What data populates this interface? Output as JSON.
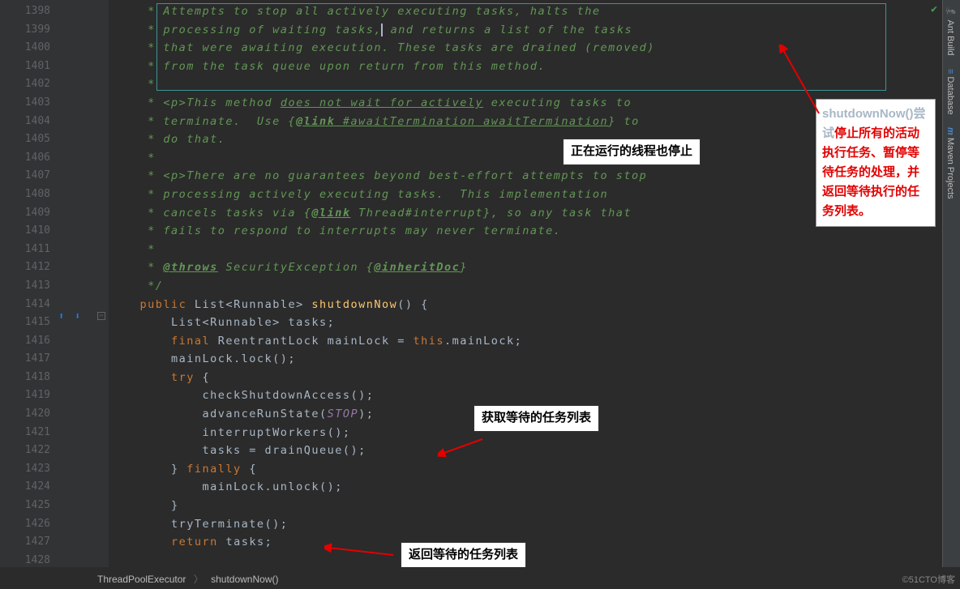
{
  "line_numbers": [
    "1398",
    "1399",
    "1400",
    "1401",
    "1402",
    "1403",
    "1404",
    "1405",
    "1406",
    "1407",
    "1408",
    "1409",
    "1410",
    "1411",
    "1412",
    "1413",
    "1414",
    "1415",
    "1416",
    "1417",
    "1418",
    "1419",
    "1420",
    "1421",
    "1422",
    "1423",
    "1424",
    "1425",
    "1426",
    "1427",
    "1428"
  ],
  "code": {
    "c1": "     * Attempts to stop all actively executing tasks, halts the",
    "c2a": "     * processing of waiting tasks,",
    "c2b": " and returns a list of the tasks",
    "c3": "     * that were awaiting execution. These tasks are drained (removed)",
    "c4": "     * from the task queue upon return from this method.",
    "c5": "     *",
    "c6a": "     * <p>This method ",
    "c6b": "does not wait for actively",
    "c6c": " executing tasks to",
    "c7a": "     * terminate.  Use {",
    "c7link": "@link",
    "c7b": " #awaitTermination awaitTermination",
    "c7c": "} to",
    "c8": "     * do that.",
    "c9": "     *",
    "c10": "     * <p>There are no guarantees beyond best-effort attempts to stop",
    "c11": "     * processing actively executing tasks.  This implementation",
    "c12a": "     * cancels tasks via {",
    "c12link": "@link",
    "c12b": " Thread#interrupt",
    "c12c": "}, so any task that",
    "c13": "     * fails to respond to interrupts may never terminate.",
    "c14": "     *",
    "c15a": "     * ",
    "c15tag": "@throws",
    "c15b": " SecurityException {",
    "c15inh": "@inheritDoc",
    "c15c": "}",
    "c16": "     */",
    "l14_kw": "public",
    "l14_type": " List<Runnable> ",
    "l14_method": "shutdownNow",
    "l14_rest": "() {",
    "l15": "        List<Runnable> tasks;",
    "l16a": "        ",
    "l16kw": "final",
    "l16b": " ReentrantLock mainLock = ",
    "l16kw2": "this",
    "l16c": ".mainLock;",
    "l17": "        mainLock.lock();",
    "l18a": "        ",
    "l18kw": "try",
    "l18b": " {",
    "l19": "            checkShutdownAccess();",
    "l20a": "            advanceRunState(",
    "l20param": "STOP",
    "l20b": ");",
    "l21": "            interruptWorkers();",
    "l22": "            tasks = drainQueue();",
    "l23a": "        } ",
    "l23kw": "finally",
    "l23b": " {",
    "l24": "            mainLock.unlock();",
    "l25": "        }",
    "l26": "        tryTerminate();",
    "l27a": "        ",
    "l27kw": "return",
    "l27b": " tasks;"
  },
  "annotations": {
    "top": "正在运行的线程也停止",
    "get_tasks": "获取等待的任务列表",
    "return_tasks": "返回等待的任务列表",
    "right_black": "shutdownNow()尝试",
    "right_red": "停止所有的活动执行任务、暂停等待任务的处理，并返回等待执行的任务列表。"
  },
  "sidebar": {
    "ant": "Ant Build",
    "db": "Database",
    "maven": "Maven Projects"
  },
  "breadcrumb": {
    "class": "ThreadPoolExecutor",
    "method": "shutdownNow()"
  },
  "watermark": "©51CTO博客"
}
